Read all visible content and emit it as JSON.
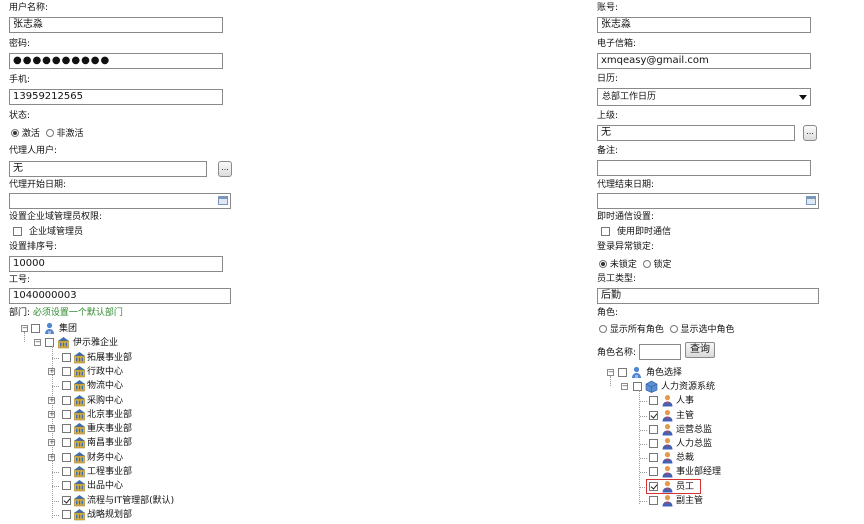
{
  "left": {
    "username_label": "用户名称:",
    "username_value": "张志淼",
    "password_label": "密码:",
    "password_value": "●●●●●●●●●●",
    "phone_label": "手机:",
    "phone_value": "13959212565",
    "status_label": "状态:",
    "status_active": "激活",
    "status_inactive": "非激活",
    "proxy_user_label": "代理人用户:",
    "proxy_user_value": "无",
    "dots_label": "...",
    "proxy_start_label": "代理开始日期:",
    "admin_perm_label": "设置企业域管理员权限:",
    "admin_cb_label": "企业域管理员",
    "sort_label": "设置排序号:",
    "sort_value": "10000",
    "job_no_label": "工号:",
    "job_no_value": "1040000003",
    "dept_label": "部门:",
    "dept_hint": "必须设置一个默认部门"
  },
  "right": {
    "account_label": "账号:",
    "account_value": "张志淼",
    "email_label": "电子信箱:",
    "email_value": "xmqeasy@gmail.com",
    "calendar_label": "日历:",
    "calendar_value": "总部工作日历",
    "superior_label": "上级:",
    "superior_value": "无",
    "remark_label": "备注:",
    "proxy_end_label": "代理结束日期:",
    "im_label": "即时通信设置:",
    "im_cb_label": "使用即时通信",
    "lock_label": "登录异常锁定:",
    "lock_unlocked": "未锁定",
    "lock_locked": "锁定",
    "emp_type_label": "员工类型:",
    "emp_type_value": "后勤",
    "role_label": "角色:",
    "role_all": "显示所有角色",
    "role_selected": "显示选中角色",
    "role_name_label": "角色名称:",
    "query_btn": "查询"
  },
  "dept_tree": [
    {
      "label": "集团",
      "checked": false,
      "icon": "group-icon"
    },
    {
      "label": "伊示雅企业",
      "checked": false,
      "icon": "building-icon"
    },
    {
      "label": "拓展事业部",
      "checked": false,
      "expandable": false
    },
    {
      "label": "行政中心",
      "checked": false,
      "expandable": true
    },
    {
      "label": "物流中心",
      "checked": false,
      "expandable": false
    },
    {
      "label": "采购中心",
      "checked": false,
      "expandable": true
    },
    {
      "label": "北京事业部",
      "checked": false,
      "expandable": true
    },
    {
      "label": "重庆事业部",
      "checked": false,
      "expandable": true
    },
    {
      "label": "南昌事业部",
      "checked": false,
      "expandable": true
    },
    {
      "label": "财务中心",
      "checked": false,
      "expandable": true
    },
    {
      "label": "工程事业部",
      "checked": false,
      "expandable": false
    },
    {
      "label": "出品中心",
      "checked": false,
      "expandable": false
    },
    {
      "label": "流程与IT管理部(默认)",
      "checked": true,
      "expandable": false
    },
    {
      "label": "战略规划部",
      "checked": false,
      "expandable": false
    }
  ],
  "role_tree": [
    {
      "label": "角色选择",
      "checked": false,
      "icon": "group-icon"
    },
    {
      "label": "人力资源系统",
      "checked": false,
      "icon": "cube-icon"
    },
    {
      "label": "人事",
      "checked": false
    },
    {
      "label": "主管",
      "checked": true
    },
    {
      "label": "运营总监",
      "checked": false
    },
    {
      "label": "人力总监",
      "checked": false
    },
    {
      "label": "总裁",
      "checked": false
    },
    {
      "label": "事业部经理",
      "checked": false
    },
    {
      "label": "员工",
      "checked": true,
      "highlighted": true
    },
    {
      "label": "副主管",
      "checked": false
    }
  ],
  "colors": {
    "hint_green": "#2e8b2e",
    "highlight_red": "#d33333"
  }
}
